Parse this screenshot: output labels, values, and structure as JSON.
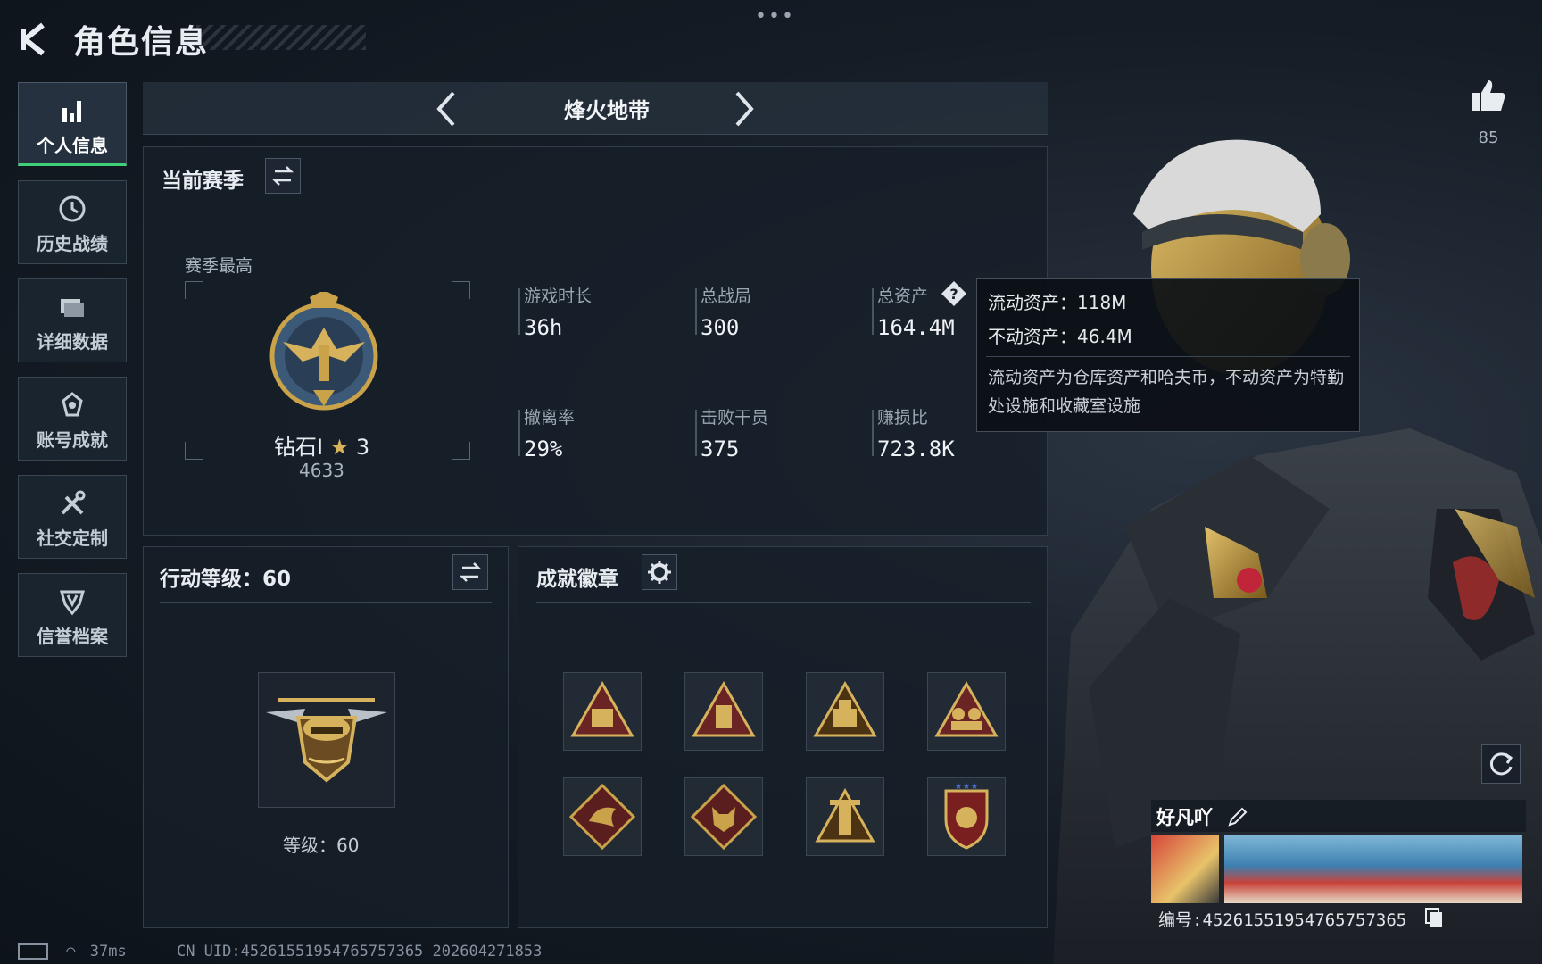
{
  "header": {
    "title": "角色信息",
    "more": "•••"
  },
  "sidebar": {
    "items": [
      {
        "label": "个人信息",
        "icon": "bar-chart-icon",
        "active": true
      },
      {
        "label": "历史战绩",
        "icon": "history-icon"
      },
      {
        "label": "详细数据",
        "icon": "folder-icon"
      },
      {
        "label": "账号成就",
        "icon": "achievement-icon"
      },
      {
        "label": "社交定制",
        "icon": "tools-icon"
      },
      {
        "label": "信誉档案",
        "icon": "credit-shield-icon"
      }
    ]
  },
  "mode_selector": {
    "current": "烽火地带"
  },
  "season": {
    "title": "当前赛季",
    "peak_label": "赛季最高",
    "rank_name": "钻石I",
    "rank_stars": "3",
    "rank_score": "4633",
    "stats": [
      {
        "label": "游戏时长",
        "value": "36h"
      },
      {
        "label": "总战局",
        "value": "300"
      },
      {
        "label": "总资产",
        "value": "164.4M"
      },
      {
        "label": "撤离率",
        "value": "29%"
      },
      {
        "label": "击败干员",
        "value": "375"
      },
      {
        "label": "赚损比",
        "value": "723.8K"
      }
    ]
  },
  "tooltip": {
    "liquid": "流动资产：118M",
    "fixed": "不动资产：46.4M",
    "description": "流动资产为仓库资产和哈夫币，不动资产为特勤处设施和收藏室设施"
  },
  "action_level": {
    "title": "行动等级：60",
    "level_text": "等级：60"
  },
  "badges": {
    "title": "成就徽章",
    "items": [
      "badge-58",
      "badge-box",
      "badge-cart",
      "badge-soldiers",
      "badge-dragon",
      "badge-wolf",
      "badge-tower",
      "badge-shield"
    ]
  },
  "likes": {
    "count": "85"
  },
  "player": {
    "name": "好凡吖",
    "id_label": "编号:4526155195476575736​5"
  },
  "status_bar": {
    "ping": "37ms",
    "uid": "CN UID:4526155195476575736​5 202604271853"
  },
  "colors": {
    "accent_green": "#3fd17a",
    "gold": "#c9a24a",
    "bg": "#151c25"
  }
}
